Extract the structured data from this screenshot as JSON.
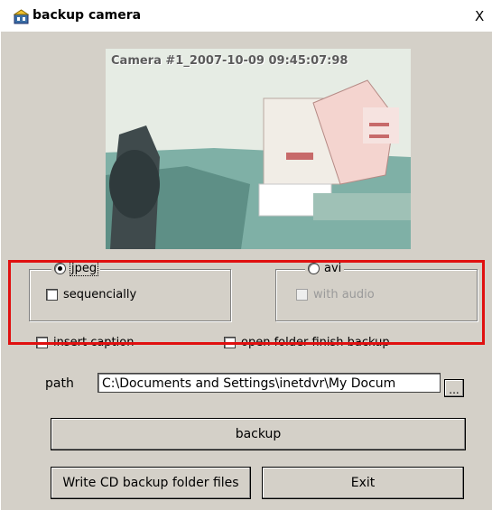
{
  "window": {
    "title": "backup camera",
    "close_glyph": "X"
  },
  "camera": {
    "caption": "Camera #1_2007-10-09 09:45:07:98"
  },
  "format_group": {
    "jpeg_label": "jpeg",
    "jpeg_selected": true,
    "sequencially_label": "sequencially",
    "sequencially_checked": false
  },
  "avi_group": {
    "avi_label": "avi",
    "avi_selected": false,
    "with_audio_label": "with audio",
    "with_audio_enabled": false
  },
  "options": {
    "insert_caption_label": "insert caption",
    "open_folder_label": "open folder finish backup"
  },
  "path": {
    "label": "path",
    "value": "C:\\Documents and Settings\\inetdvr\\My Docum",
    "browse_label": "..."
  },
  "buttons": {
    "backup": "backup",
    "write_cd": "Write CD backup folder files",
    "exit": "Exit"
  },
  "colors": {
    "dialog_bg": "#d4d0c8",
    "highlight": "#e01010"
  }
}
